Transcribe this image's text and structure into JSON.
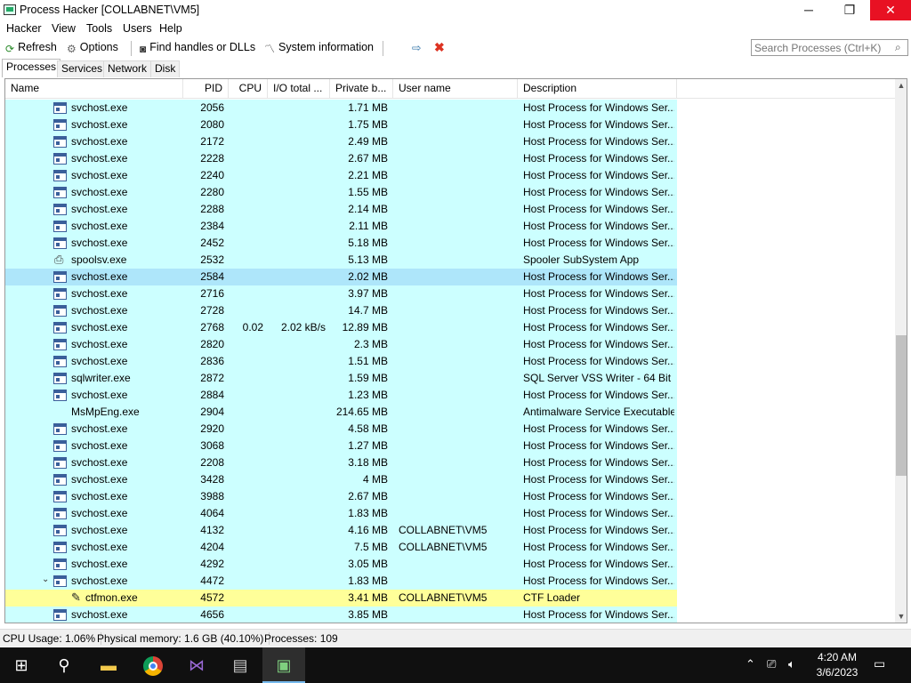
{
  "window": {
    "title": "Process Hacker [COLLABNET\\VM5]",
    "min_glyph": "─",
    "max_glyph": "❐",
    "close_glyph": "✕"
  },
  "menu": [
    "Hacker",
    "View",
    "Tools",
    "Users",
    "Help"
  ],
  "toolbar": {
    "refresh": "Refresh",
    "options": "Options",
    "find_handles": "Find handles or DLLs",
    "system_info": "System information"
  },
  "search": {
    "placeholder": "Search Processes (Ctrl+K)"
  },
  "tabs": [
    "Processes",
    "Services",
    "Network",
    "Disk"
  ],
  "columns": {
    "name": "Name",
    "pid": "PID",
    "cpu": "CPU",
    "io": "I/O total ...",
    "private": "Private b...",
    "user": "User name",
    "description": "Description"
  },
  "rows": [
    {
      "name": "svchost.exe",
      "pid": "2056",
      "cpu": "",
      "io": "",
      "priv": "1.71 MB",
      "user": "",
      "desc": "Host Process for Windows Ser...",
      "icon": "window-icon",
      "state": ""
    },
    {
      "name": "svchost.exe",
      "pid": "2080",
      "cpu": "",
      "io": "",
      "priv": "1.75 MB",
      "user": "",
      "desc": "Host Process for Windows Ser...",
      "icon": "window-icon",
      "state": ""
    },
    {
      "name": "svchost.exe",
      "pid": "2172",
      "cpu": "",
      "io": "",
      "priv": "2.49 MB",
      "user": "",
      "desc": "Host Process for Windows Ser...",
      "icon": "window-icon",
      "state": ""
    },
    {
      "name": "svchost.exe",
      "pid": "2228",
      "cpu": "",
      "io": "",
      "priv": "2.67 MB",
      "user": "",
      "desc": "Host Process for Windows Ser...",
      "icon": "window-icon",
      "state": ""
    },
    {
      "name": "svchost.exe",
      "pid": "2240",
      "cpu": "",
      "io": "",
      "priv": "2.21 MB",
      "user": "",
      "desc": "Host Process for Windows Ser...",
      "icon": "window-icon",
      "state": ""
    },
    {
      "name": "svchost.exe",
      "pid": "2280",
      "cpu": "",
      "io": "",
      "priv": "1.55 MB",
      "user": "",
      "desc": "Host Process for Windows Ser...",
      "icon": "window-icon",
      "state": ""
    },
    {
      "name": "svchost.exe",
      "pid": "2288",
      "cpu": "",
      "io": "",
      "priv": "2.14 MB",
      "user": "",
      "desc": "Host Process for Windows Ser...",
      "icon": "window-icon",
      "state": ""
    },
    {
      "name": "svchost.exe",
      "pid": "2384",
      "cpu": "",
      "io": "",
      "priv": "2.11 MB",
      "user": "",
      "desc": "Host Process for Windows Ser...",
      "icon": "window-icon",
      "state": ""
    },
    {
      "name": "svchost.exe",
      "pid": "2452",
      "cpu": "",
      "io": "",
      "priv": "5.18 MB",
      "user": "",
      "desc": "Host Process for Windows Ser...",
      "icon": "window-icon",
      "state": ""
    },
    {
      "name": "spoolsv.exe",
      "pid": "2532",
      "cpu": "",
      "io": "",
      "priv": "5.13 MB",
      "user": "",
      "desc": "Spooler SubSystem App",
      "icon": "printer-icon",
      "state": ""
    },
    {
      "name": "svchost.exe",
      "pid": "2584",
      "cpu": "",
      "io": "",
      "priv": "2.02 MB",
      "user": "",
      "desc": "Host Process for Windows Ser...",
      "icon": "window-icon",
      "state": "selected"
    },
    {
      "name": "svchost.exe",
      "pid": "2716",
      "cpu": "",
      "io": "",
      "priv": "3.97 MB",
      "user": "",
      "desc": "Host Process for Windows Ser...",
      "icon": "window-icon",
      "state": ""
    },
    {
      "name": "svchost.exe",
      "pid": "2728",
      "cpu": "",
      "io": "",
      "priv": "14.7 MB",
      "user": "",
      "desc": "Host Process for Windows Ser...",
      "icon": "window-icon",
      "state": ""
    },
    {
      "name": "svchost.exe",
      "pid": "2768",
      "cpu": "0.02",
      "io": "2.02 kB/s",
      "priv": "12.89 MB",
      "user": "",
      "desc": "Host Process for Windows Ser...",
      "icon": "window-icon",
      "state": ""
    },
    {
      "name": "svchost.exe",
      "pid": "2820",
      "cpu": "",
      "io": "",
      "priv": "2.3 MB",
      "user": "",
      "desc": "Host Process for Windows Ser...",
      "icon": "window-icon",
      "state": ""
    },
    {
      "name": "svchost.exe",
      "pid": "2836",
      "cpu": "",
      "io": "",
      "priv": "1.51 MB",
      "user": "",
      "desc": "Host Process for Windows Ser...",
      "icon": "window-icon",
      "state": ""
    },
    {
      "name": "sqlwriter.exe",
      "pid": "2872",
      "cpu": "",
      "io": "",
      "priv": "1.59 MB",
      "user": "",
      "desc": "SQL Server VSS Writer - 64 Bit",
      "icon": "window-icon",
      "state": ""
    },
    {
      "name": "svchost.exe",
      "pid": "2884",
      "cpu": "",
      "io": "",
      "priv": "1.23 MB",
      "user": "",
      "desc": "Host Process for Windows Ser...",
      "icon": "window-icon",
      "state": ""
    },
    {
      "name": "MsMpEng.exe",
      "pid": "2904",
      "cpu": "",
      "io": "",
      "priv": "214.65 MB",
      "user": "",
      "desc": "Antimalware Service Executable",
      "icon": "blank-icon",
      "state": ""
    },
    {
      "name": "svchost.exe",
      "pid": "2920",
      "cpu": "",
      "io": "",
      "priv": "4.58 MB",
      "user": "",
      "desc": "Host Process for Windows Ser...",
      "icon": "window-icon",
      "state": ""
    },
    {
      "name": "svchost.exe",
      "pid": "3068",
      "cpu": "",
      "io": "",
      "priv": "1.27 MB",
      "user": "",
      "desc": "Host Process for Windows Ser...",
      "icon": "window-icon",
      "state": ""
    },
    {
      "name": "svchost.exe",
      "pid": "2208",
      "cpu": "",
      "io": "",
      "priv": "3.18 MB",
      "user": "",
      "desc": "Host Process for Windows Ser...",
      "icon": "window-icon",
      "state": ""
    },
    {
      "name": "svchost.exe",
      "pid": "3428",
      "cpu": "",
      "io": "",
      "priv": "4 MB",
      "user": "",
      "desc": "Host Process for Windows Ser...",
      "icon": "window-icon",
      "state": ""
    },
    {
      "name": "svchost.exe",
      "pid": "3988",
      "cpu": "",
      "io": "",
      "priv": "2.67 MB",
      "user": "",
      "desc": "Host Process for Windows Ser...",
      "icon": "window-icon",
      "state": ""
    },
    {
      "name": "svchost.exe",
      "pid": "4064",
      "cpu": "",
      "io": "",
      "priv": "1.83 MB",
      "user": "",
      "desc": "Host Process for Windows Ser...",
      "icon": "window-icon",
      "state": ""
    },
    {
      "name": "svchost.exe",
      "pid": "4132",
      "cpu": "",
      "io": "",
      "priv": "4.16 MB",
      "user": "COLLABNET\\VM5",
      "desc": "Host Process for Windows Ser...",
      "icon": "window-icon",
      "state": ""
    },
    {
      "name": "svchost.exe",
      "pid": "4204",
      "cpu": "",
      "io": "",
      "priv": "7.5 MB",
      "user": "COLLABNET\\VM5",
      "desc": "Host Process for Windows Ser...",
      "icon": "window-icon",
      "state": ""
    },
    {
      "name": "svchost.exe",
      "pid": "4292",
      "cpu": "",
      "io": "",
      "priv": "3.05 MB",
      "user": "",
      "desc": "Host Process for Windows Ser...",
      "icon": "window-icon",
      "state": ""
    },
    {
      "name": "svchost.exe",
      "pid": "4472",
      "cpu": "",
      "io": "",
      "priv": "1.83 MB",
      "user": "",
      "desc": "Host Process for Windows Ser...",
      "icon": "window-icon",
      "state": "expanded"
    },
    {
      "name": "ctfmon.exe",
      "pid": "4572",
      "cpu": "",
      "io": "",
      "priv": "3.41 MB",
      "user": "COLLABNET\\VM5",
      "desc": "CTF Loader",
      "icon": "pen-icon",
      "state": "highlight-child"
    },
    {
      "name": "svchost.exe",
      "pid": "4656",
      "cpu": "",
      "io": "",
      "priv": "3.85 MB",
      "user": "",
      "desc": "Host Process for Windows Ser...",
      "icon": "window-icon",
      "state": ""
    }
  ],
  "status": {
    "cpu": "CPU Usage: 1.06%",
    "memory": "Physical memory: 1.6 GB (40.10%)",
    "processes": "Processes: 109"
  },
  "taskbar": {
    "icons": [
      "windows-start-icon",
      "search-icon",
      "file-explorer-icon",
      "chrome-icon",
      "visual-studio-icon",
      "network-app-icon",
      "process-hacker-icon"
    ],
    "time": "4:20 AM",
    "date": "3/6/2023"
  },
  "colors": {
    "service_row": "#ccffff",
    "selected_row": "#aee6fa",
    "user_row": "#ffff99",
    "close_button": "#e81123"
  }
}
